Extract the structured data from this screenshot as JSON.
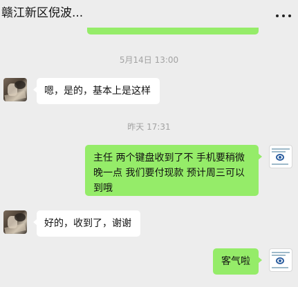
{
  "header": {
    "title": "赣江新区倪波..."
  },
  "messages": [
    {
      "kind": "time",
      "text": "5月14日 13:00"
    },
    {
      "kind": "in",
      "text": "嗯，是的，基本上是这样"
    },
    {
      "kind": "time",
      "text": "昨天 17:31"
    },
    {
      "kind": "out",
      "text": "主任  两个键盘收到了不  手机要稍微晚一点 我们要付现款  预计周三可以到哦"
    },
    {
      "kind": "in",
      "text": "好的，收到了，谢谢"
    },
    {
      "kind": "out",
      "text": "客气啦"
    }
  ],
  "colors": {
    "background": "#ededed",
    "outgoing_bubble": "#95ec69",
    "incoming_bubble": "#ffffff",
    "timestamp_text": "#a2a2a2"
  },
  "icons": {
    "more": "more-dots-icon"
  }
}
